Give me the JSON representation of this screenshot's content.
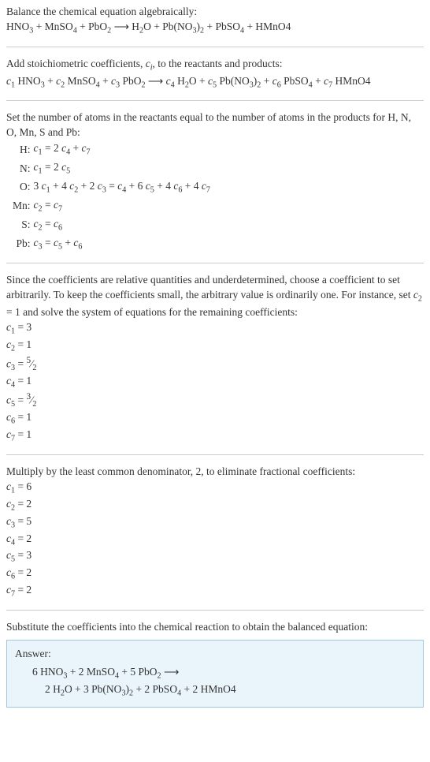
{
  "intro": {
    "line1": "Balance the chemical equation algebraically:",
    "line2_html": "HNO<sub>3</sub> + MnSO<sub>4</sub> + PbO<sub>2</sub>  ⟶  H<sub>2</sub>O + Pb(NO<sub>3</sub>)<sub>2</sub> + PbSO<sub>4</sub> + HMnO4"
  },
  "stoich": {
    "line1_html": "Add stoichiometric coefficients, <i>c<sub>i</sub></i>, to the reactants and products:",
    "line2_html": "<i>c</i><sub>1</sub> HNO<sub>3</sub> + <i>c</i><sub>2</sub> MnSO<sub>4</sub> + <i>c</i><sub>3</sub> PbO<sub>2</sub>  ⟶  <i>c</i><sub>4</sub> H<sub>2</sub>O + <i>c</i><sub>5</sub> Pb(NO<sub>3</sub>)<sub>2</sub> + <i>c</i><sub>6</sub> PbSO<sub>4</sub> + <i>c</i><sub>7</sub> HMnO4"
  },
  "atoms": {
    "intro": "Set the number of atoms in the reactants equal to the number of atoms in the products for H, N, O, Mn, S and Pb:",
    "rows": [
      {
        "elem": "H:",
        "eq_html": "<i>c</i><sub>1</sub> = 2 <i>c</i><sub>4</sub> + <i>c</i><sub>7</sub>"
      },
      {
        "elem": "N:",
        "eq_html": "<i>c</i><sub>1</sub> = 2 <i>c</i><sub>5</sub>"
      },
      {
        "elem": "O:",
        "eq_html": "3 <i>c</i><sub>1</sub> + 4 <i>c</i><sub>2</sub> + 2 <i>c</i><sub>3</sub> = <i>c</i><sub>4</sub> + 6 <i>c</i><sub>5</sub> + 4 <i>c</i><sub>6</sub> + 4 <i>c</i><sub>7</sub>"
      },
      {
        "elem": "Mn:",
        "eq_html": "<i>c</i><sub>2</sub> = <i>c</i><sub>7</sub>"
      },
      {
        "elem": "S:",
        "eq_html": "<i>c</i><sub>2</sub> = <i>c</i><sub>6</sub>"
      },
      {
        "elem": "Pb:",
        "eq_html": "<i>c</i><sub>3</sub> = <i>c</i><sub>5</sub> + <i>c</i><sub>6</sub>"
      }
    ]
  },
  "solve": {
    "intro_html": "Since the coefficients are relative quantities and underdetermined, choose a coefficient to set arbitrarily. To keep the coefficients small, the arbitrary value is ordinarily one. For instance, set <i>c</i><sub>2</sub> = 1 and solve the system of equations for the remaining coefficients:",
    "coeffs_html": [
      "<i>c</i><sub>1</sub> = 3",
      "<i>c</i><sub>2</sub> = 1",
      "<i>c</i><sub>3</sub> = <sup>5</sup>&frasl;<sub>2</sub>",
      "<i>c</i><sub>4</sub> = 1",
      "<i>c</i><sub>5</sub> = <sup>3</sup>&frasl;<sub>2</sub>",
      "<i>c</i><sub>6</sub> = 1",
      "<i>c</i><sub>7</sub> = 1"
    ]
  },
  "lcd": {
    "intro": "Multiply by the least common denominator, 2, to eliminate fractional coefficients:",
    "coeffs_html": [
      "<i>c</i><sub>1</sub> = 6",
      "<i>c</i><sub>2</sub> = 2",
      "<i>c</i><sub>3</sub> = 5",
      "<i>c</i><sub>4</sub> = 2",
      "<i>c</i><sub>5</sub> = 3",
      "<i>c</i><sub>6</sub> = 2",
      "<i>c</i><sub>7</sub> = 2"
    ]
  },
  "final": {
    "intro": "Substitute the coefficients into the chemical reaction to obtain the balanced equation:",
    "answer_label": "Answer:",
    "line1_html": "6 HNO<sub>3</sub> + 2 MnSO<sub>4</sub> + 5 PbO<sub>2</sub>  ⟶",
    "line2_html": "2 H<sub>2</sub>O + 3 Pb(NO<sub>3</sub>)<sub>2</sub> + 2 PbSO<sub>4</sub> + 2 HMnO4"
  }
}
